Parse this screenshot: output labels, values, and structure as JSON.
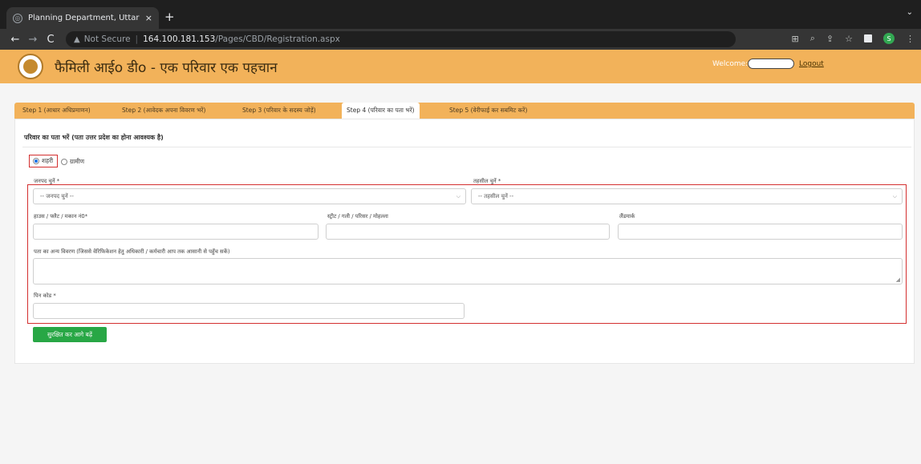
{
  "browser": {
    "tab_title": "Planning Department, Uttar Pr...",
    "tab_close": "×",
    "new_tab": "+",
    "not_secure": "Not Secure",
    "url_host": "164.100.181.153",
    "url_path": "/Pages/CBD/Registration.aspx",
    "profile_letter": "S"
  },
  "header": {
    "title": "फैमिली आईo डीo - एक परिवार एक पहचान",
    "welcome_label": "Welcome:",
    "logout_label": "Logout"
  },
  "steps": [
    {
      "label": "Step 1 (आधार अधिप्रमाणन)"
    },
    {
      "label": "Step 2 (आवेदक अपना विवरण भरें)"
    },
    {
      "label": "Step 3 (परिवार के सदस्य जोड़ें)"
    },
    {
      "label": "Step 4 (परिवार का पता भरें)"
    },
    {
      "label": "Step 5 (वेरीफाई कर सबमिट करें)"
    }
  ],
  "active_step": 4,
  "form": {
    "section_title": "परिवार का पता भरें (पता उत्तर प्रदेश का होना आवश्यक है)",
    "radio_urban": "शहरी",
    "radio_rural": "ग्रामीण",
    "selected_area": "urban",
    "district_label": "जनपद चुनें *",
    "district_placeholder": "-- जनपद चुनें --",
    "tehsil_label": "तहसील चुनें *",
    "tehsil_placeholder": "-- तहसील चुनें --",
    "house_label": "हाउस / फ्लैट / मकान नं0*",
    "street_label": "स्ट्रीट / गली / परिसर / मोहल्ला",
    "landmark_label": "लैंडमार्क",
    "other_details_label": "पता का अन्य विवरण (जिससे वेरिफिकेशन हेतु अधिकारी / कर्मचारी आप तक आसानी से पहुँच सकें)",
    "pincode_label": "पिन कोड *",
    "save_button": "सुरक्षित कर आगे बढ़ें"
  },
  "colors": {
    "header_bg": "#f2b25a",
    "active_tab_bg": "#ffffff",
    "save_button_bg": "#28a745",
    "highlight_border": "#d32f2f"
  }
}
